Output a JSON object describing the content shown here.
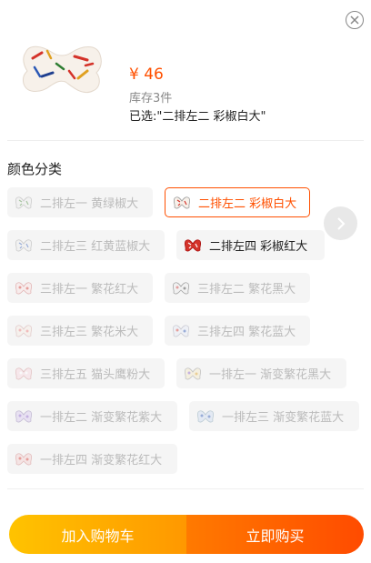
{
  "product": {
    "price": "¥ 46",
    "stock": "库存3件",
    "selected": "已选:\"二排左二 彩椒白大\""
  },
  "section": {
    "title": "颜色分类"
  },
  "options": [
    "二排左一 黄绿椒大",
    "二排左二 彩椒白大",
    "二排左三 红黄蓝椒大",
    "二排左四  彩椒红大",
    "三排左一 繁花红大",
    "三排左二 繁花黑大",
    "三排左三 繁花米大",
    "三排左四 繁花蓝大",
    "三排左五 猫头鹰粉大",
    "一排左一 渐变繁花黑大",
    "一排左二 渐变繁花紫大",
    "一排左三 渐变繁花蓝大",
    "一排左四 渐变繁花红大"
  ],
  "buttons": {
    "cart": "加入购物车",
    "buy": "立即购买"
  },
  "colors": {
    "accent": "#ff5000",
    "cart_start": "#ffc300",
    "buy_end": "#ff4b00"
  },
  "icons": {
    "close": "close-icon",
    "next": "chevron-right-icon",
    "option": "bow-pillow-icon"
  }
}
